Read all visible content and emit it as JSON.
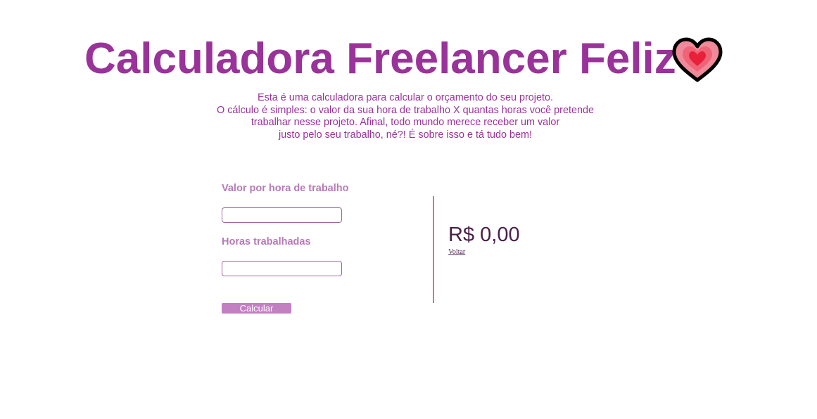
{
  "header": {
    "title": "Calculadora Freelancer Feliz",
    "icon": "heart-icon"
  },
  "intro": {
    "lines": [
      "Esta é uma calculadora para calcular o orçamento do seu projeto.",
      "O cálculo é simples: o valor da sua hora de trabalho X quantas horas você pretende",
      "trabalhar nesse projeto. Afinal, todo mundo merece receber um valor",
      "justo pelo seu trabalho, né?! É sobre isso e tá tudo bem!"
    ]
  },
  "form": {
    "hour_value_label": "Valor por hora de trabalho",
    "hour_value": "",
    "hours_label": "Horas trabalhadas",
    "hours": "",
    "submit_label": "Calcular"
  },
  "result": {
    "amount": "R$ 0,00",
    "back_label": "Voltar"
  },
  "colors": {
    "title": "#993399",
    "label": "#b67bb6",
    "button": "#c27fc2",
    "result": "#4a1f4a",
    "heart_outer": "#ef8a9a",
    "heart_inner": "#e8203a"
  }
}
